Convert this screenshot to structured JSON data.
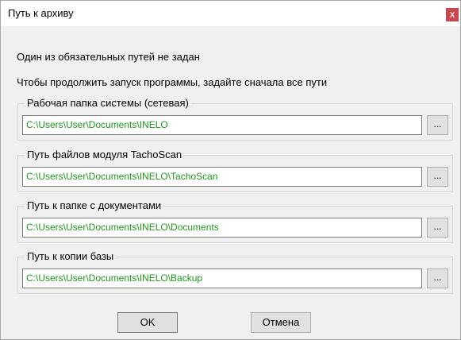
{
  "window": {
    "title": "Путь к архиву",
    "close_glyph": "x"
  },
  "messages": {
    "line1": "Один из обязательных путей не задан",
    "line2": "Чтобы продолжить запуск программы, задайте сначала все пути"
  },
  "groups": [
    {
      "label": "Рабочая папка системы (сетевая)",
      "path": "C:\\Users\\User\\Documents\\INELO",
      "browse_label": "..."
    },
    {
      "label": "Путь файлов модуля TachoScan",
      "path": "C:\\Users\\User\\Documents\\INELO\\TachoScan",
      "browse_label": "..."
    },
    {
      "label": "Путь к папке с документами",
      "path": "C:\\Users\\User\\Documents\\INELO\\Documents",
      "browse_label": "..."
    },
    {
      "label": "Путь к копии базы",
      "path": "C:\\Users\\User\\Documents\\INELO\\Backup",
      "browse_label": "..."
    }
  ],
  "buttons": {
    "ok": "OK",
    "cancel": "Отмена"
  },
  "colors": {
    "path_text": "#1b9a1b",
    "close_button": "#c9464c"
  }
}
